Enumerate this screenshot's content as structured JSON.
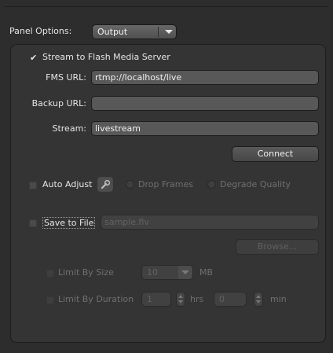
{
  "header": {
    "panel_options_label": "Panel Options:",
    "panel_options_value": "Output"
  },
  "stream": {
    "checkbox_label": "Stream to Flash Media Server",
    "checked": true,
    "fms_url_label": "FMS URL:",
    "fms_url_value": "rtmp://localhost/live",
    "backup_url_label": "Backup URL:",
    "backup_url_value": "",
    "stream_label": "Stream:",
    "stream_value": "livestream",
    "connect_label": "Connect"
  },
  "auto_adjust": {
    "label": "Auto Adjust",
    "checked": false,
    "drop_frames_label": "Drop Frames",
    "degrade_quality_label": "Degrade Quality"
  },
  "save_to_file": {
    "label": "Save to File",
    "checked": false,
    "filename_value": "sample.flv",
    "browse_label": "Browse..."
  },
  "limit_by_size": {
    "label": "Limit By Size",
    "value": "10",
    "unit": "MB"
  },
  "limit_by_duration": {
    "label": "Limit By Duration",
    "hours_value": "1",
    "hours_unit": "hrs",
    "minutes_value": "0",
    "minutes_unit": "min"
  },
  "colors": {
    "background": "#2d2d2d",
    "panel": "#343434",
    "field": "#585858",
    "text": "#e6e6e6",
    "disabled_text": "#6f6f6f"
  }
}
